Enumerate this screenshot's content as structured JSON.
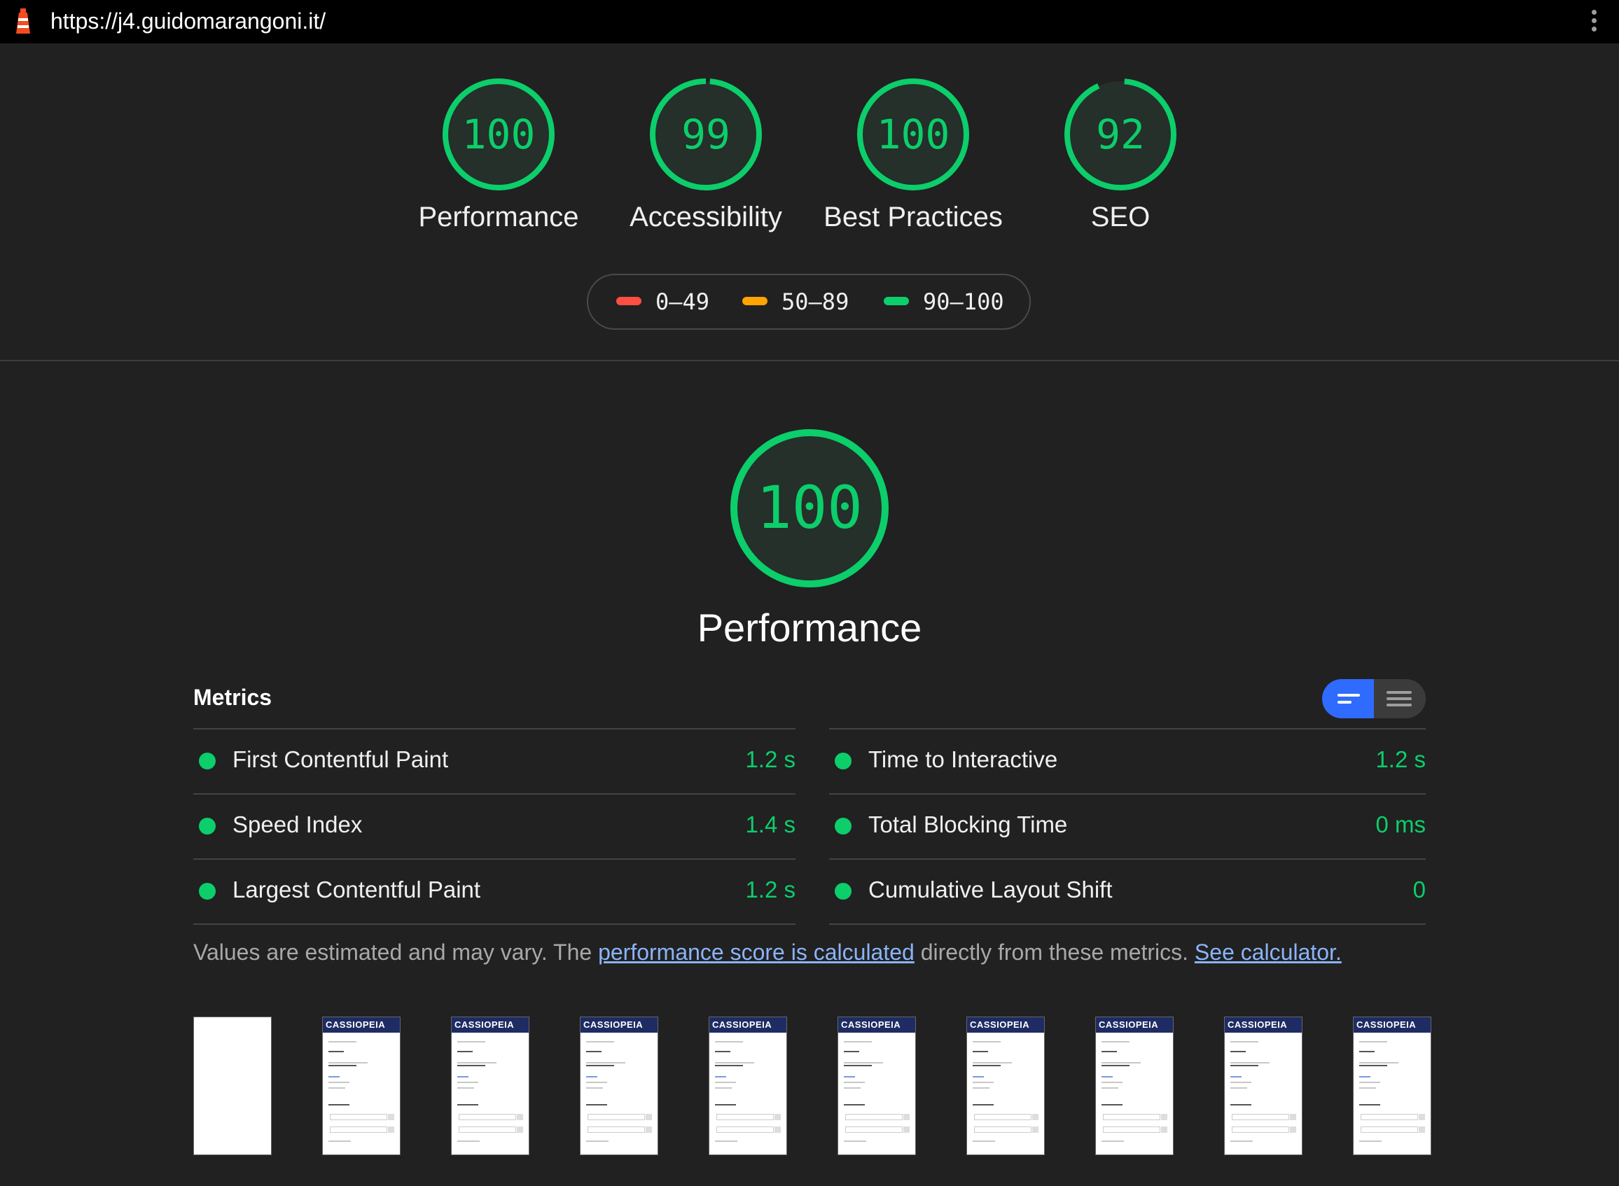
{
  "topbar": {
    "url": "https://j4.guidomarangoni.it/",
    "logo_icon": "lighthouse-icon",
    "menu_icon": "kebab-menu-icon"
  },
  "gauges": [
    {
      "score": 100,
      "label": "Performance"
    },
    {
      "score": 99,
      "label": "Accessibility"
    },
    {
      "score": 100,
      "label": "Best Practices"
    },
    {
      "score": 92,
      "label": "SEO"
    }
  ],
  "legend": [
    {
      "range": "0–49",
      "color": "#ff4e42"
    },
    {
      "range": "50–89",
      "color": "#ffa400"
    },
    {
      "range": "90–100",
      "color": "#0cce6b"
    }
  ],
  "performance": {
    "score": 100,
    "title": "Performance"
  },
  "metrics": {
    "title": "Metrics",
    "toggle_icons": [
      "summary-view-icon",
      "expanded-view-icon"
    ],
    "left": [
      {
        "name": "First Contentful Paint",
        "value": "1.2 s"
      },
      {
        "name": "Speed Index",
        "value": "1.4 s"
      },
      {
        "name": "Largest Contentful Paint",
        "value": "1.2 s"
      }
    ],
    "right": [
      {
        "name": "Time to Interactive",
        "value": "1.2 s"
      },
      {
        "name": "Total Blocking Time",
        "value": "0 ms"
      },
      {
        "name": "Cumulative Layout Shift",
        "value": "0"
      }
    ]
  },
  "note": {
    "prefix": "Values are estimated and may vary. The ",
    "link1": "performance score is calculated",
    "middle": " directly from these metrics. ",
    "link2": "See calculator."
  },
  "filmstrip": {
    "frame_count": 10,
    "frame_brand": "CASSIOPEIA"
  },
  "colors": {
    "pass": "#0cce6b",
    "background": "#212121",
    "toggle_active": "#2f6bff",
    "link": "#8ab4f8"
  }
}
